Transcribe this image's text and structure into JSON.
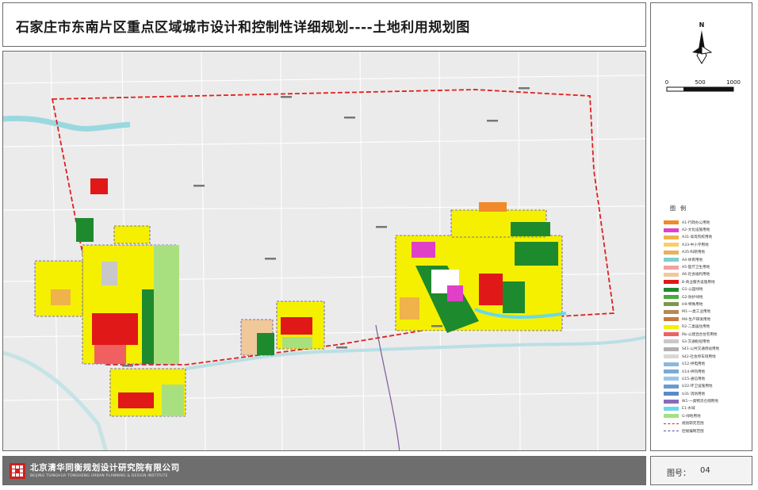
{
  "title": "石家庄市东南片区重点区域城市设计和控制性详细规划----土地利用规划图",
  "north_label": "N",
  "scale_labels": [
    "0",
    "500",
    "1000"
  ],
  "legend_title": "图例",
  "legend": [
    {
      "label": "A1-行政办公用地",
      "color": "#f08a2a"
    },
    {
      "label": "A2-文化设施用地",
      "color": "#e040c8"
    },
    {
      "label": "A31-高等院校用地",
      "color": "#f0b24a"
    },
    {
      "label": "A33-中小学用地",
      "color": "#f5cf6a"
    },
    {
      "label": "A35-科研用地",
      "color": "#e8b060"
    },
    {
      "label": "A4-体育用地",
      "color": "#7fcfd0"
    },
    {
      "label": "A5-医疗卫生用地",
      "color": "#f4a0a0"
    },
    {
      "label": "A6-社会福利用地",
      "color": "#f0c89a"
    },
    {
      "label": "B-商业服务设施用地",
      "color": "#e01818"
    },
    {
      "label": "G1-公园绿地",
      "color": "#1e8a2e"
    },
    {
      "label": "G2-防护绿地",
      "color": "#4caa3c"
    },
    {
      "label": "H9-特殊用地",
      "color": "#7a9a4a"
    },
    {
      "label": "M1-一类工业用地",
      "color": "#b48a5a"
    },
    {
      "label": "M4-生产研发用地",
      "color": "#c87a3a"
    },
    {
      "label": "R2-二类居住用地",
      "color": "#f5f000"
    },
    {
      "label": "Rb-公建混合住宅用地",
      "color": "#f06060"
    },
    {
      "label": "S3-交通枢纽用地",
      "color": "#c8c8c8"
    },
    {
      "label": "S41-公共交通场站用地",
      "color": "#b0b0b0"
    },
    {
      "label": "S42-社会停车场用地",
      "color": "#d8d8d8"
    },
    {
      "label": "U12-供电用地",
      "color": "#8ab8e0"
    },
    {
      "label": "U14-供热用地",
      "color": "#7aaad8"
    },
    {
      "label": "U15-通信用地",
      "color": "#9ac4e8"
    },
    {
      "label": "U22-环卫设施用地",
      "color": "#6a9ad0"
    },
    {
      "label": "U31-消防用地",
      "color": "#5a8ac8"
    },
    {
      "label": "W1-一类物流仓储用地",
      "color": "#8a6ab8"
    },
    {
      "label": "E1-水域",
      "color": "#6ad8e8"
    },
    {
      "label": "G-绿地用地",
      "color": "#a8e080"
    },
    {
      "label": "规划研究范围",
      "color": "#e02020",
      "line": "red"
    },
    {
      "label": "控规编制范围",
      "color": "#5a4fa8",
      "line": "purple"
    }
  ],
  "footer": {
    "company_cn": "北京清华同衡规划设计研究院有限公司",
    "company_en": "BEIJING TSINGHUA TONGHENG URBAN PLANNING & DESIGN INSTITUTE"
  },
  "figure_number": {
    "label": "图号：",
    "value": "04"
  },
  "colors": {
    "residential": "#f5f000",
    "commercial": "#e01818",
    "park": "#1e8a2e",
    "green_buffer": "#a8e080",
    "water": "#9ad8e0",
    "boundary": "#e02020",
    "control_boundary": "#5a4fa8",
    "background": "#ebebeb"
  }
}
